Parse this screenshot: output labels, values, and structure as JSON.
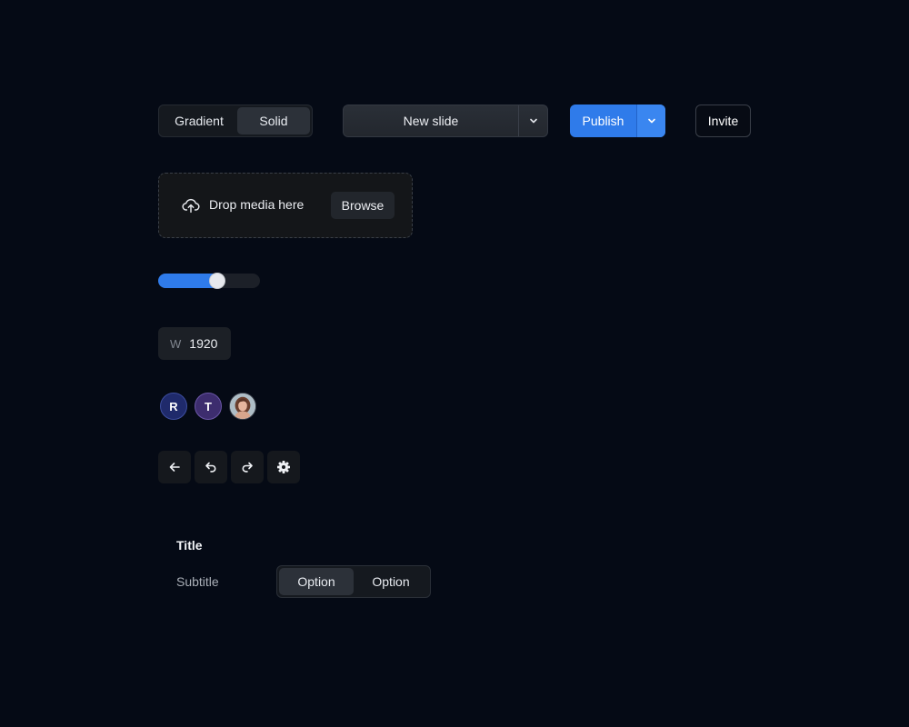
{
  "fill_toggle": {
    "options": [
      "Gradient",
      "Solid"
    ],
    "selected": "Solid"
  },
  "new_slide": {
    "label": "New slide",
    "caret_icon": "chevron-down-icon"
  },
  "publish": {
    "label": "Publish",
    "caret_icon": "chevron-down-icon",
    "color": "#2f7bea"
  },
  "invite": {
    "label": "Invite"
  },
  "dropzone": {
    "icon": "upload-cloud-icon",
    "text": "Drop media here",
    "browse_label": "Browse"
  },
  "slider": {
    "value_fraction": 0.58,
    "fill_color": "#2f7bea"
  },
  "width_field": {
    "prefix": "W",
    "value": "1920"
  },
  "avatars": [
    {
      "initial": "R",
      "color": "#1f2a6b"
    },
    {
      "initial": "T",
      "color": "#3d2d6e"
    },
    {
      "initial": "",
      "type": "photo"
    }
  ],
  "toolbar_icons": [
    "arrow-left-icon",
    "undo-icon",
    "redo-icon",
    "gear-icon"
  ],
  "form": {
    "title": "Title",
    "subtitle": "Subtitle",
    "options": [
      "Option",
      "Option"
    ],
    "selected_index": 0
  }
}
